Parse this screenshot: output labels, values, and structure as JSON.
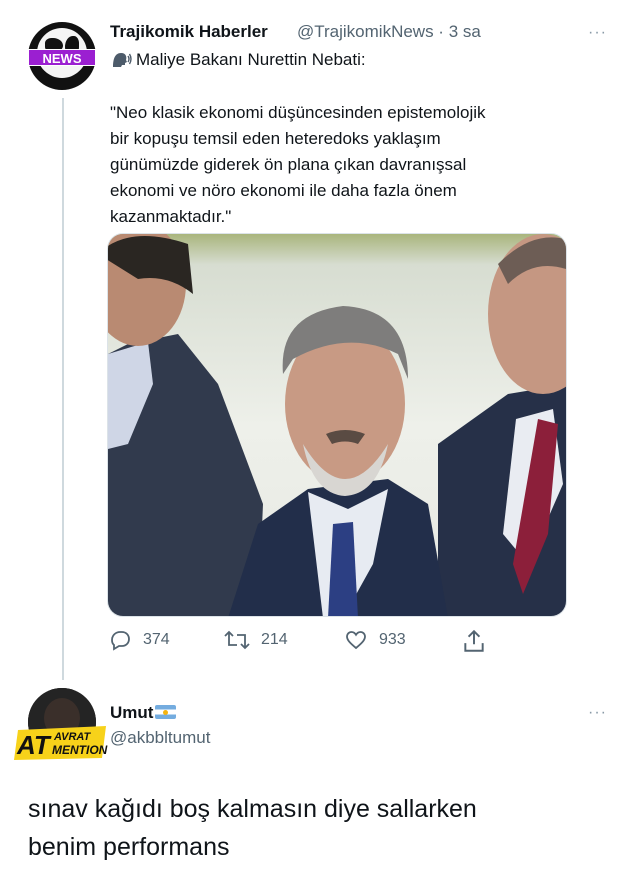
{
  "tweet": {
    "badge": "NEWS",
    "author_name": "Trajikomik Haberler",
    "handle_time": "@TrajikomikNews · 3 sa",
    "more": "···",
    "speaker_line": "Maliye Bakanı Nurettin Nebati:",
    "quote": "\"Neo klasik ekonomi düşüncesinden epistemolojik\nbir kopuşu temsil eden heteredoks yaklaşım\ngünümüzde giderek ön plana çıkan davranışsal\nekonomi ve nöro ekonomi ile daha fazla önem\nkazanmaktadır.\"",
    "replies": "374",
    "retweets": "214",
    "likes": "933",
    "icons": [
      "speaking-head-icon",
      "reply-icon",
      "retweet-icon",
      "like-icon",
      "share-icon"
    ]
  },
  "reply": {
    "author_name": "Umut",
    "handle": "@akbbltumut",
    "more": "···",
    "badge_main": "AT",
    "badge_top": "AVRAT",
    "badge_bottom": "MENTION",
    "text": "sınav kağıdı boş kalmasın diye sallarken\nbenim performans",
    "flag": "argentina-flag-icon"
  },
  "colors": {
    "primary_text": "#0f1419",
    "secondary_text": "#536471",
    "news_badge": "#9b1fd1",
    "at_badge": "#f7d21a",
    "thread_line": "#cfd9de"
  }
}
